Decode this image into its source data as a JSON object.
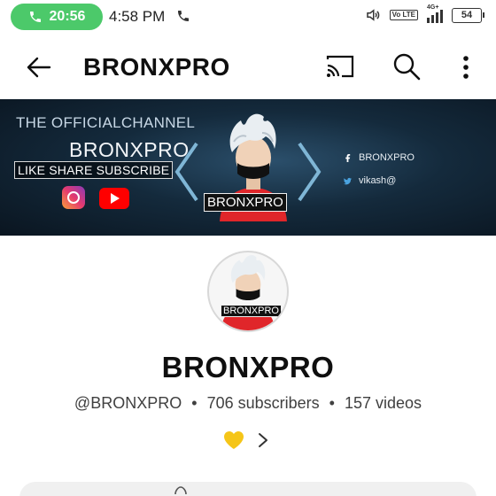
{
  "status_bar": {
    "call_timer": "20:56",
    "time": "4:58 PM",
    "volte_label": "Vo LTE",
    "network_label": "4G+",
    "battery": "54"
  },
  "app_bar": {
    "title": "BRONXPRO",
    "icons": [
      "back-arrow-icon",
      "cast-icon",
      "search-icon",
      "more-vert-icon"
    ]
  },
  "banner": {
    "official": "THE OFFICIALCHANNEL",
    "name": "BRONXPRO",
    "tagline": "LIKE SHARE SUBSCRIBE",
    "avatar_tag": "BRONXPRO",
    "facebook": "BRONXPRO",
    "twitter": "vikash@"
  },
  "channel": {
    "avatar_tag": "BRONXPRO",
    "name": "BRONXPRO",
    "handle": "@BRONXPRO",
    "subscribers": "706 subscribers",
    "videos": "157 videos",
    "separator": "•"
  },
  "colors": {
    "call_pill": "#4cc96a",
    "youtube_red": "#ff0000",
    "heart_yellow": "#f5c518",
    "banner_dark": "#0a1520"
  }
}
